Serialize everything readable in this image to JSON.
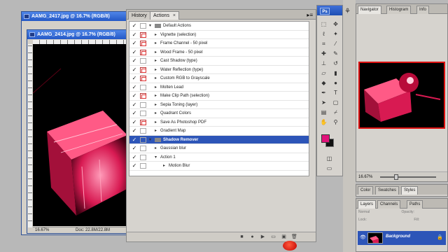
{
  "documents": [
    {
      "title": "AAMG_2417.jpg @ 16.7% (RGB/8)"
    },
    {
      "title": "AAMG_2414.jpg @ 16.7% (RGB/8)",
      "zoom": "16.67%",
      "doc_info": "Doc: 22.8M/22.8M"
    }
  ],
  "actions_panel": {
    "tabs": [
      {
        "label": "History"
      },
      {
        "label": "Actions"
      }
    ],
    "tab_close": "×",
    "menu_icon": "▸≡",
    "rows": [
      {
        "label": "Default Actions",
        "check": "✓",
        "dialog": false,
        "type": "set",
        "open": true
      },
      {
        "label": "Vignette (selection)",
        "check": "✓",
        "dialog": true,
        "type": "action"
      },
      {
        "label": "Frame Channel - 50 pixel",
        "check": "✓",
        "dialog": true,
        "type": "action"
      },
      {
        "label": "Wood Frame - 50 pixel",
        "check": "✓",
        "dialog": true,
        "type": "action"
      },
      {
        "label": "Cast Shadow (type)",
        "check": "✓",
        "dialog": false,
        "type": "action"
      },
      {
        "label": "Water Reflection (type)",
        "check": "✓",
        "dialog": true,
        "type": "action"
      },
      {
        "label": "Custom RGB to Grayscale",
        "check": "✓",
        "dialog": true,
        "type": "action"
      },
      {
        "label": "Molten Lead",
        "check": "✓",
        "dialog": false,
        "type": "action"
      },
      {
        "label": "Make Clip Path (selection)",
        "check": "✓",
        "dialog": true,
        "type": "action"
      },
      {
        "label": "Sepia Toning (layer)",
        "check": "✓",
        "dialog": false,
        "type": "action"
      },
      {
        "label": "Quadrant Colors",
        "check": "✓",
        "dialog": false,
        "type": "action"
      },
      {
        "label": "Save As Photoshop PDF",
        "check": "✓",
        "dialog": true,
        "type": "action"
      },
      {
        "label": "Gradient Map",
        "check": "✓",
        "dialog": false,
        "type": "action"
      },
      {
        "label": "Shadow Remover",
        "check": "✓",
        "dialog": false,
        "type": "set",
        "open": true,
        "selected": true
      },
      {
        "label": "Gaussian blur",
        "check": "✓",
        "dialog": false,
        "type": "action"
      },
      {
        "label": "Action 1",
        "check": "✓",
        "dialog": false,
        "type": "action",
        "open": true
      },
      {
        "label": "Motion Blur",
        "check": "✓",
        "dialog": false,
        "type": "step"
      }
    ],
    "bottom_buttons": [
      "■",
      "●",
      "▶",
      "▭",
      "▣",
      "🗑"
    ]
  },
  "tools_panel": {
    "logo": "Ps",
    "fg_color": "#e0137a",
    "bg_color": "#111111"
  },
  "navigator": {
    "tabs": [
      {
        "label": "Navigator"
      },
      {
        "label": "Histogram"
      },
      {
        "label": "Info"
      }
    ],
    "zoom": "16.67%"
  },
  "color_panel": {
    "tabs": [
      {
        "label": "Color"
      },
      {
        "label": "Swatches"
      },
      {
        "label": "Styles"
      }
    ]
  },
  "layers_panel": {
    "tabs": [
      {
        "label": "Layers"
      },
      {
        "label": "Channels"
      },
      {
        "label": "Paths"
      }
    ],
    "blend_mode": "Normal",
    "opacity_label": "Opacity:",
    "lock_label": "Lock:",
    "fill_label": "Fill:",
    "layer_name": "Background"
  },
  "colors": {
    "selection": "#2d55b8",
    "accent": "#e0137a",
    "record": "#d80000"
  }
}
